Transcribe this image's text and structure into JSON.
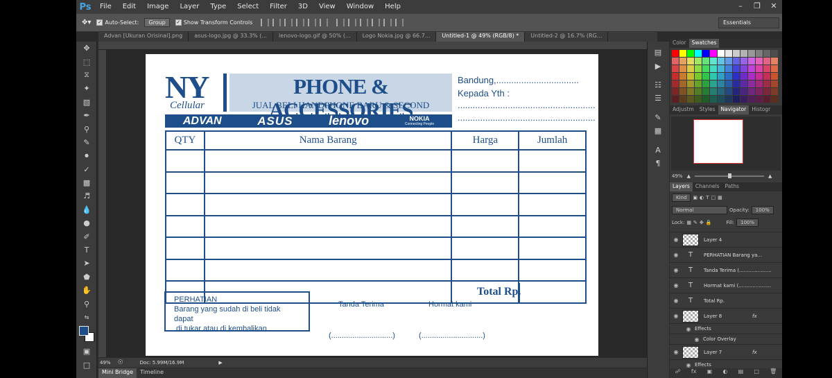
{
  "menubar": {
    "app_logo": "Ps",
    "items": [
      "File",
      "Edit",
      "Image",
      "Layer",
      "Type",
      "Select",
      "Filter",
      "3D",
      "View",
      "Window",
      "Help"
    ]
  },
  "options": {
    "auto_select_label": "Auto-Select:",
    "auto_select_value": "Group",
    "show_transform_label": "Show Transform Controls",
    "workspace": "Essentials"
  },
  "tabs": [
    "Advan [Ukuran Orisinal].png",
    "asus-logo.jpg @ 33.3% (...",
    "lenovo-logo.gif @ 50% (...",
    "Logo Nokia.jpg @ 66.7...",
    "Untitled-1 @ 49% (RGB/8) *",
    "Untitled-2 @ 16.7% (RG..."
  ],
  "active_tab_index": 4,
  "document": {
    "logo_big": "NY",
    "logo_sub": "Cellular",
    "title": "PHONE & ACCESSORIES",
    "subtitle": "JUAL BELI HANDPHONE BARU & SECOND",
    "brands": [
      "ADVAN",
      "ASUS",
      "lenovo",
      "NOKIA"
    ],
    "nokia_tagline": "Connecting People",
    "address_line1": "Bandung,.................................",
    "address_line2": "Kepada Yth :",
    "address_line3": ".......................................................",
    "address_line4": ".......................................................",
    "table_headers": [
      "QTY",
      "Nama Barang",
      "Harga",
      "Jumlah"
    ],
    "empty_rows": 7,
    "total_label": "Total Rp.",
    "notice_title": "PERHATIAN",
    "notice_line1": "Barang yang sudah di beli tidak dapat",
    "notice_line2": "di tukar atau di kembalikan",
    "receiver_label": "Tanda Terima",
    "sender_label": "Hormat kami",
    "receiver_blank": "(.............................)",
    "sender_blank": "(.............................)"
  },
  "status": {
    "zoom": "49%",
    "doc_size": "Doc: 5.99M/16.9M"
  },
  "bottom_tabs": [
    "Mini Bridge",
    "Timeline"
  ],
  "right_panel": {
    "color_tabs": [
      "Color",
      "Swatches"
    ],
    "nav_tabs": [
      "Adjustm",
      "Styles",
      "Navigator",
      "Histogr"
    ],
    "nav_zoom": "49%",
    "layer_tabs": [
      "Layers",
      "Channels",
      "Paths"
    ],
    "kind_label": "Kind",
    "blend_mode": "Normal",
    "opacity_label": "Opacity:",
    "opacity_value": "100%",
    "lock_label": "Lock:",
    "fill_label": "Fill:",
    "fill_value": "100%",
    "layers": [
      {
        "name": "Layer 4",
        "type": "raster"
      },
      {
        "name": "PERHATIAN Barang ya...",
        "type": "text"
      },
      {
        "name": "Tanda Terima    (.....................",
        "type": "text"
      },
      {
        "name": "Hormat kami    (.....................",
        "type": "text"
      },
      {
        "name": "Total Rp.",
        "type": "text"
      },
      {
        "name": "Layer 8",
        "type": "raster",
        "fx": true
      },
      {
        "name": "Effects",
        "type": "sub"
      },
      {
        "name": "Color Overlay",
        "type": "sub2"
      },
      {
        "name": "Layer 7",
        "type": "raster",
        "fx": true
      },
      {
        "name": "Effects",
        "type": "sub"
      }
    ]
  },
  "colors": {
    "doc_blue": "#1d4e89",
    "doc_title_bg": "#c8d6e5",
    "ps_blue": "#4aa3df"
  }
}
